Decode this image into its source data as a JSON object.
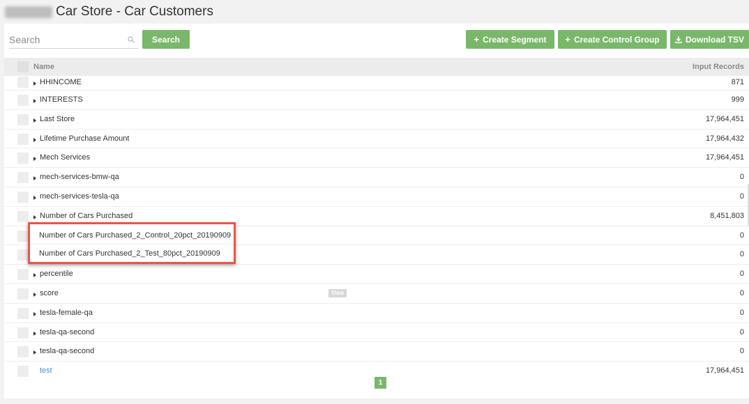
{
  "header": {
    "title": "Car Store - Car Customers"
  },
  "search": {
    "placeholder": "Search",
    "button_label": "Search"
  },
  "toolbar": {
    "create_segment": "Create Segment",
    "create_control_group": "Create Control Group",
    "download_tsv": "Download TSV"
  },
  "table": {
    "columns": {
      "name": "Name",
      "records": "Input Records"
    },
    "rows": [
      {
        "name": "HHINCOME",
        "records": "871"
      },
      {
        "name": "INTERESTS",
        "records": "999"
      },
      {
        "name": "Last Store",
        "records": "17,964,451"
      },
      {
        "name": "Lifetime Purchase Amount",
        "records": "17,964,432"
      },
      {
        "name": "Mech Services",
        "records": "17,964,451"
      },
      {
        "name": "mech-services-bmw-qa",
        "records": "0"
      },
      {
        "name": "mech-services-tesla-qa",
        "records": "0"
      },
      {
        "name": "Number of Cars Purchased",
        "records": "8,451,803"
      },
      {
        "name": "Number of Cars Purchased_2_Control_20pct_20190909",
        "records": "0"
      },
      {
        "name": "Number of Cars Purchased_2_Test_80pct_20190909",
        "records": "0"
      },
      {
        "name": "percentile",
        "records": "0"
      },
      {
        "name": "score",
        "records": "0",
        "badge": "View"
      },
      {
        "name": "tesla-female-qa",
        "records": "0"
      },
      {
        "name": "tesla-qa-second",
        "records": "0"
      },
      {
        "name": "tesla-qa-second",
        "records": "0"
      },
      {
        "name": "test",
        "records": "17,964,451"
      }
    ]
  },
  "pagination": {
    "current_page": "1"
  },
  "colors": {
    "accent": "#79b86a",
    "highlight_border": "#e8554a",
    "link": "#4a90c9"
  },
  "icons": {
    "search": "search-icon",
    "plus": "plus-icon",
    "download": "download-icon",
    "caret": "caret-right-icon"
  }
}
